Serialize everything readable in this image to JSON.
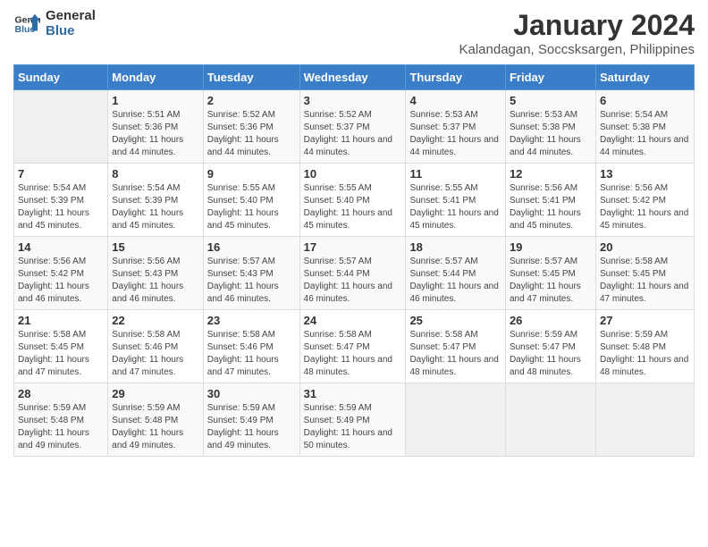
{
  "logo": {
    "line1": "General",
    "line2": "Blue"
  },
  "title": "January 2024",
  "subtitle": "Kalandagan, Soccsksargen, Philippines",
  "days_header": [
    "Sunday",
    "Monday",
    "Tuesday",
    "Wednesday",
    "Thursday",
    "Friday",
    "Saturday"
  ],
  "weeks": [
    [
      {
        "num": "",
        "sunrise": "",
        "sunset": "",
        "daylight": "",
        "empty": true
      },
      {
        "num": "1",
        "sunrise": "Sunrise: 5:51 AM",
        "sunset": "Sunset: 5:36 PM",
        "daylight": "Daylight: 11 hours and 44 minutes."
      },
      {
        "num": "2",
        "sunrise": "Sunrise: 5:52 AM",
        "sunset": "Sunset: 5:36 PM",
        "daylight": "Daylight: 11 hours and 44 minutes."
      },
      {
        "num": "3",
        "sunrise": "Sunrise: 5:52 AM",
        "sunset": "Sunset: 5:37 PM",
        "daylight": "Daylight: 11 hours and 44 minutes."
      },
      {
        "num": "4",
        "sunrise": "Sunrise: 5:53 AM",
        "sunset": "Sunset: 5:37 PM",
        "daylight": "Daylight: 11 hours and 44 minutes."
      },
      {
        "num": "5",
        "sunrise": "Sunrise: 5:53 AM",
        "sunset": "Sunset: 5:38 PM",
        "daylight": "Daylight: 11 hours and 44 minutes."
      },
      {
        "num": "6",
        "sunrise": "Sunrise: 5:54 AM",
        "sunset": "Sunset: 5:38 PM",
        "daylight": "Daylight: 11 hours and 44 minutes."
      }
    ],
    [
      {
        "num": "7",
        "sunrise": "Sunrise: 5:54 AM",
        "sunset": "Sunset: 5:39 PM",
        "daylight": "Daylight: 11 hours and 45 minutes."
      },
      {
        "num": "8",
        "sunrise": "Sunrise: 5:54 AM",
        "sunset": "Sunset: 5:39 PM",
        "daylight": "Daylight: 11 hours and 45 minutes."
      },
      {
        "num": "9",
        "sunrise": "Sunrise: 5:55 AM",
        "sunset": "Sunset: 5:40 PM",
        "daylight": "Daylight: 11 hours and 45 minutes."
      },
      {
        "num": "10",
        "sunrise": "Sunrise: 5:55 AM",
        "sunset": "Sunset: 5:40 PM",
        "daylight": "Daylight: 11 hours and 45 minutes."
      },
      {
        "num": "11",
        "sunrise": "Sunrise: 5:55 AM",
        "sunset": "Sunset: 5:41 PM",
        "daylight": "Daylight: 11 hours and 45 minutes."
      },
      {
        "num": "12",
        "sunrise": "Sunrise: 5:56 AM",
        "sunset": "Sunset: 5:41 PM",
        "daylight": "Daylight: 11 hours and 45 minutes."
      },
      {
        "num": "13",
        "sunrise": "Sunrise: 5:56 AM",
        "sunset": "Sunset: 5:42 PM",
        "daylight": "Daylight: 11 hours and 45 minutes."
      }
    ],
    [
      {
        "num": "14",
        "sunrise": "Sunrise: 5:56 AM",
        "sunset": "Sunset: 5:42 PM",
        "daylight": "Daylight: 11 hours and 46 minutes."
      },
      {
        "num": "15",
        "sunrise": "Sunrise: 5:56 AM",
        "sunset": "Sunset: 5:43 PM",
        "daylight": "Daylight: 11 hours and 46 minutes."
      },
      {
        "num": "16",
        "sunrise": "Sunrise: 5:57 AM",
        "sunset": "Sunset: 5:43 PM",
        "daylight": "Daylight: 11 hours and 46 minutes."
      },
      {
        "num": "17",
        "sunrise": "Sunrise: 5:57 AM",
        "sunset": "Sunset: 5:44 PM",
        "daylight": "Daylight: 11 hours and 46 minutes."
      },
      {
        "num": "18",
        "sunrise": "Sunrise: 5:57 AM",
        "sunset": "Sunset: 5:44 PM",
        "daylight": "Daylight: 11 hours and 46 minutes."
      },
      {
        "num": "19",
        "sunrise": "Sunrise: 5:57 AM",
        "sunset": "Sunset: 5:45 PM",
        "daylight": "Daylight: 11 hours and 47 minutes."
      },
      {
        "num": "20",
        "sunrise": "Sunrise: 5:58 AM",
        "sunset": "Sunset: 5:45 PM",
        "daylight": "Daylight: 11 hours and 47 minutes."
      }
    ],
    [
      {
        "num": "21",
        "sunrise": "Sunrise: 5:58 AM",
        "sunset": "Sunset: 5:45 PM",
        "daylight": "Daylight: 11 hours and 47 minutes."
      },
      {
        "num": "22",
        "sunrise": "Sunrise: 5:58 AM",
        "sunset": "Sunset: 5:46 PM",
        "daylight": "Daylight: 11 hours and 47 minutes."
      },
      {
        "num": "23",
        "sunrise": "Sunrise: 5:58 AM",
        "sunset": "Sunset: 5:46 PM",
        "daylight": "Daylight: 11 hours and 47 minutes."
      },
      {
        "num": "24",
        "sunrise": "Sunrise: 5:58 AM",
        "sunset": "Sunset: 5:47 PM",
        "daylight": "Daylight: 11 hours and 48 minutes."
      },
      {
        "num": "25",
        "sunrise": "Sunrise: 5:58 AM",
        "sunset": "Sunset: 5:47 PM",
        "daylight": "Daylight: 11 hours and 48 minutes."
      },
      {
        "num": "26",
        "sunrise": "Sunrise: 5:59 AM",
        "sunset": "Sunset: 5:47 PM",
        "daylight": "Daylight: 11 hours and 48 minutes."
      },
      {
        "num": "27",
        "sunrise": "Sunrise: 5:59 AM",
        "sunset": "Sunset: 5:48 PM",
        "daylight": "Daylight: 11 hours and 48 minutes."
      }
    ],
    [
      {
        "num": "28",
        "sunrise": "Sunrise: 5:59 AM",
        "sunset": "Sunset: 5:48 PM",
        "daylight": "Daylight: 11 hours and 49 minutes."
      },
      {
        "num": "29",
        "sunrise": "Sunrise: 5:59 AM",
        "sunset": "Sunset: 5:48 PM",
        "daylight": "Daylight: 11 hours and 49 minutes."
      },
      {
        "num": "30",
        "sunrise": "Sunrise: 5:59 AM",
        "sunset": "Sunset: 5:49 PM",
        "daylight": "Daylight: 11 hours and 49 minutes."
      },
      {
        "num": "31",
        "sunrise": "Sunrise: 5:59 AM",
        "sunset": "Sunset: 5:49 PM",
        "daylight": "Daylight: 11 hours and 50 minutes."
      },
      {
        "num": "",
        "sunrise": "",
        "sunset": "",
        "daylight": "",
        "empty": true
      },
      {
        "num": "",
        "sunrise": "",
        "sunset": "",
        "daylight": "",
        "empty": true
      },
      {
        "num": "",
        "sunrise": "",
        "sunset": "",
        "daylight": "",
        "empty": true
      }
    ]
  ]
}
